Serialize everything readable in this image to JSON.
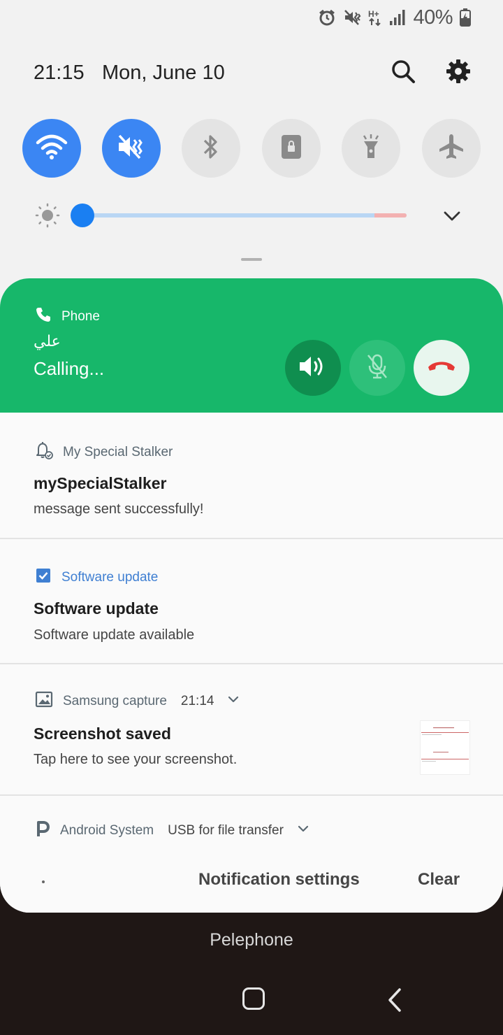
{
  "status_bar": {
    "battery_percent": "40%",
    "icons": [
      "alarm-icon",
      "mute-vibrate-icon",
      "h-plus-data-icon",
      "signal-icon",
      "battery-charging-icon"
    ]
  },
  "header": {
    "time": "21:15",
    "date": "Mon, June 10",
    "icons": [
      "search-icon",
      "gear-icon"
    ]
  },
  "quick_settings": {
    "toggles": [
      {
        "icon": "wifi-icon",
        "active": true
      },
      {
        "icon": "mute-icon",
        "active": true
      },
      {
        "icon": "bluetooth-icon",
        "active": false
      },
      {
        "icon": "rotation-lock-icon",
        "active": false
      },
      {
        "icon": "flashlight-icon",
        "active": false
      },
      {
        "icon": "airplane-icon",
        "active": false
      }
    ],
    "brightness_level": 0.0,
    "colors": {
      "active": "#3b86f3",
      "inactive": "#e4e4e4",
      "slider": "#1a7ff2"
    }
  },
  "call": {
    "app": "Phone",
    "caller": "علي",
    "state": "Calling...",
    "color": "#17b76a",
    "buttons": [
      "speaker-icon",
      "mic-off-icon",
      "end-call-icon"
    ]
  },
  "notifications": [
    {
      "app": "My Special Stalker",
      "title": "mySpecialStalker",
      "text": "message sent successfully!"
    },
    {
      "app": "Software update",
      "title": "Software update",
      "text": "Software update available"
    },
    {
      "app": "Samsung capture",
      "time": "21:14",
      "title": "Screenshot saved",
      "text": "Tap here to see your screenshot."
    },
    {
      "app": "Android System",
      "extra": "USB for file transfer"
    }
  ],
  "footer": {
    "settings_label": "Notification settings",
    "clear_label": "Clear"
  },
  "carrier": "Pelephone"
}
